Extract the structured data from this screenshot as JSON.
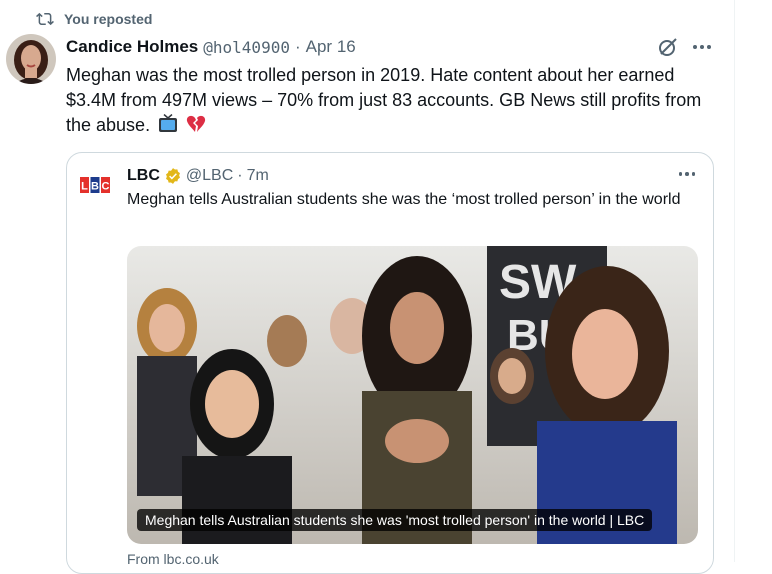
{
  "repost": {
    "label": "You reposted",
    "icon": "repost-icon"
  },
  "tweet": {
    "author_name": "Candice Holmes",
    "handle": "@hol40900",
    "separator": "·",
    "date": "Apr 16",
    "text": "Meghan was the most trolled person in 2019. Hate content about her earned $3.4M from 497M views – 70% from just 83 accounts. GB News still profits from the abuse.",
    "emojis": [
      "tv-emoji",
      "broken-heart-emoji"
    ]
  },
  "quote": {
    "author_name": "LBC",
    "handle": "@LBC",
    "separator": "·",
    "time": "7m",
    "logo_text": "LBC",
    "text": "Meghan tells Australian students she was the ‘most trolled person’ in the world",
    "image_caption": "Meghan tells Australian students she was 'most trolled person' in the world | LBC",
    "source": "From lbc.co.uk",
    "verified_color": "#e2b719"
  },
  "colors": {
    "text": "#0f1419",
    "muted": "#536471",
    "border": "#cfd9de"
  }
}
